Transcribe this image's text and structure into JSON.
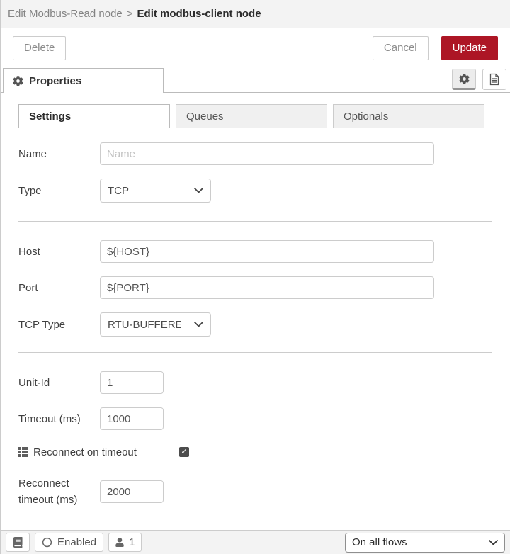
{
  "breadcrumb": {
    "parent": "Edit Modbus-Read node",
    "separator": ">",
    "current": "Edit modbus-client node"
  },
  "toolbar": {
    "delete_label": "Delete",
    "cancel_label": "Cancel",
    "update_label": "Update"
  },
  "panel": {
    "properties_tab_label": "Properties"
  },
  "tabs": {
    "settings": "Settings",
    "queues": "Queues",
    "optionals": "Optionals"
  },
  "form": {
    "name": {
      "label": "Name",
      "placeholder": "Name",
      "value": ""
    },
    "type": {
      "label": "Type",
      "value": "TCP"
    },
    "host": {
      "label": "Host",
      "value": "${HOST}"
    },
    "port": {
      "label": "Port",
      "value": "${PORT}"
    },
    "tcp_type": {
      "label": "TCP Type",
      "value": "RTU-BUFFERED"
    },
    "unit_id": {
      "label": "Unit-Id",
      "value": "1"
    },
    "timeout": {
      "label": "Timeout (ms)",
      "value": "1000"
    },
    "reconnect_on_timeout": {
      "label": "Reconnect on timeout",
      "checked": true,
      "check_glyph": "✓"
    },
    "reconnect_timeout": {
      "label_line1": "Reconnect",
      "label_line2": "timeout (ms)",
      "value": "2000"
    }
  },
  "footer": {
    "enabled_label": "Enabled",
    "user_count": "1",
    "deploy_scope_value": "On all flows"
  },
  "colors": {
    "accent_red": "#AD1625",
    "breadcrumb_bg": "#f3f3f3",
    "footer_bg": "#f3f3f3",
    "border": "#cccccc"
  }
}
